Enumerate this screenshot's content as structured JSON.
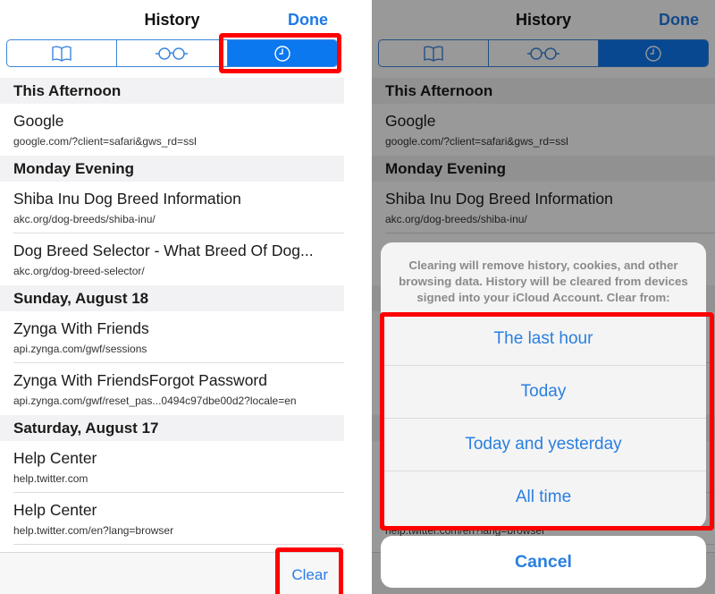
{
  "nav": {
    "title": "History",
    "done_label": "Done"
  },
  "segments": [
    {
      "name": "bookmarks",
      "icon": "book-icon",
      "active": false
    },
    {
      "name": "reading-list",
      "icon": "glasses-icon",
      "active": false
    },
    {
      "name": "history",
      "icon": "clock-icon",
      "active": true
    }
  ],
  "history": {
    "sections": [
      {
        "header": "This Afternoon",
        "items": [
          {
            "title": "Google",
            "url": "google.com/?client=safari&gws_rd=ssl"
          }
        ]
      },
      {
        "header": "Monday Evening",
        "items": [
          {
            "title": "Shiba Inu Dog Breed Information",
            "url": "akc.org/dog-breeds/shiba-inu/"
          },
          {
            "title": "Dog Breed Selector - What Breed Of Dog...",
            "url": "akc.org/dog-breed-selector/"
          }
        ]
      },
      {
        "header": "Sunday, August 18",
        "items": [
          {
            "title": "Zynga With Friends",
            "url": "api.zynga.com/gwf/sessions"
          },
          {
            "title": "Zynga With FriendsForgot Password",
            "url": "api.zynga.com/gwf/reset_pas...0494c97dbe00d2?locale=en"
          }
        ]
      },
      {
        "header": "Saturday, August 17",
        "items": [
          {
            "title": "Help Center",
            "url": "help.twitter.com"
          },
          {
            "title": "Help Center",
            "url": "help.twitter.com/en?lang=browser"
          }
        ]
      }
    ]
  },
  "toolbar": {
    "clear_label": "Clear"
  },
  "action_sheet": {
    "message": "Clearing will remove history, cookies, and other browsing data. History will be cleared from devices signed into your iCloud Account. Clear from:",
    "options": [
      "The last hour",
      "Today",
      "Today and yesterday",
      "All time"
    ],
    "cancel_label": "Cancel"
  },
  "colors": {
    "accent": "#0c78f0",
    "link": "#2a7fdf",
    "highlight": "#ff0000"
  }
}
